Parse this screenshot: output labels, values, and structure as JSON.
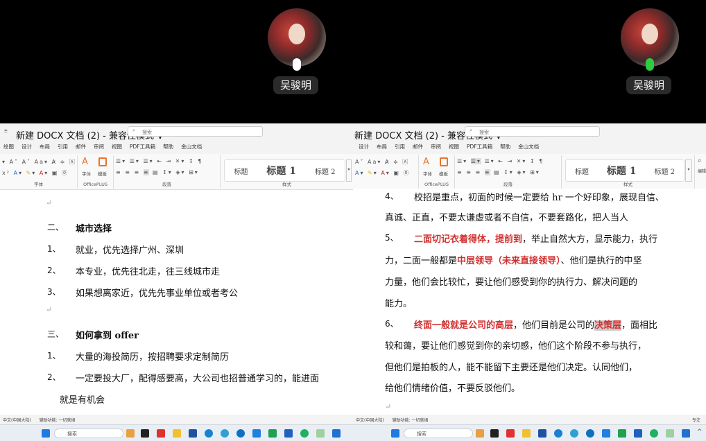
{
  "call": {
    "participants": [
      {
        "name": "吴骏明",
        "mic": "muted"
      },
      {
        "name": "吴骏明",
        "mic": "speaking"
      }
    ]
  },
  "left": {
    "title": "新建 DOCX 文档 (2) - 兼容性模式 ∨",
    "search_placeholder": "搜索",
    "tabs": [
      "绘图",
      "设计",
      "布局",
      "引用",
      "邮件",
      "审阅",
      "视图",
      "PDF工具箱",
      "帮助",
      "金山文档"
    ],
    "groups": {
      "font": "字体",
      "officeplus": "OfficePLUS",
      "font_btn": "字体",
      "template_btn": "模板",
      "paragraph": "段落",
      "styles": "样式"
    },
    "styles": [
      "标题",
      "标题 1",
      "标题 2"
    ],
    "doc": {
      "h2_num": "二、",
      "h2": "城市选择",
      "items1": [
        {
          "n": "1、",
          "t": "就业，优先选择广州、深圳"
        },
        {
          "n": "2、",
          "t": "本专业，优先往北走，往三线城市走"
        },
        {
          "n": "3、",
          "t": "如果想离家近，优先先事业单位或者考公"
        }
      ],
      "h3_num": "三、",
      "h3": "如何拿到 offer",
      "items2": [
        {
          "n": "1、",
          "t": "大量的海投简历，按招聘要求定制简历"
        },
        {
          "n": "2、",
          "t": "一定要投大厂，配得感要高，大公司也招普通学习的，能进面",
          "t2": "就是有机会"
        }
      ]
    },
    "status": {
      "lang": "中文(中国大陆)",
      "accessibility": "辅助功能: 一切就绪"
    }
  },
  "right": {
    "title": "新建 DOCX 文档 (2) - 兼容性模式 ∨",
    "search_placeholder": "搜索",
    "tabs": [
      "设计",
      "布局",
      "引用",
      "邮件",
      "审阅",
      "视图",
      "PDF工具箱",
      "帮助",
      "金山文档"
    ],
    "groups": {
      "officeplus": "OfficePLUS",
      "font_btn": "字体",
      "template_btn": "模板",
      "paragraph": "段落",
      "styles": "样式",
      "edit": "编辑"
    },
    "styles": [
      "标题",
      "标题 1",
      "标题 2"
    ],
    "doc": {
      "i4": {
        "n": "4、",
        "a": "校招是重点，初面的时候一定要给 hr 一个好印象，展现自信、",
        "b": "真诚、正直，不要太谦虚或者不自信，不要套路化，把人当人"
      },
      "i5": {
        "n": "5、",
        "red1": "二面切记衣着得体，提前到",
        "a": "，举止自然大方，显示能力，执行",
        "b1": "力，二面一般都是",
        "red2": "中层领导（未来直接领导）",
        "b2": "、他们是执行的中坚",
        "c": "力量，他们会比较忙，要让他们感受到你的执行力、解决问题的",
        "d": "能力。"
      },
      "i6": {
        "n": "6、",
        "red1": "终面一般就是公司的高层",
        "a1": "，他们目前是公司的",
        "red2": "决策层",
        "a2": "，面相比",
        "b": "较和蔼，要让他们感觉到你的亲切感，他们这个阶段不参与执行，",
        "c": "但他们是拍板的人，能不能留下主要还是他们决定。认同他们，",
        "d": "给他们情绪价值，不要反驳他们。"
      }
    },
    "status": {
      "lang": "中文(中国大陆)",
      "accessibility": "辅助功能: 一切就绪",
      "focus": "专注"
    }
  },
  "taskbar": {
    "search_placeholder": "搜索"
  }
}
